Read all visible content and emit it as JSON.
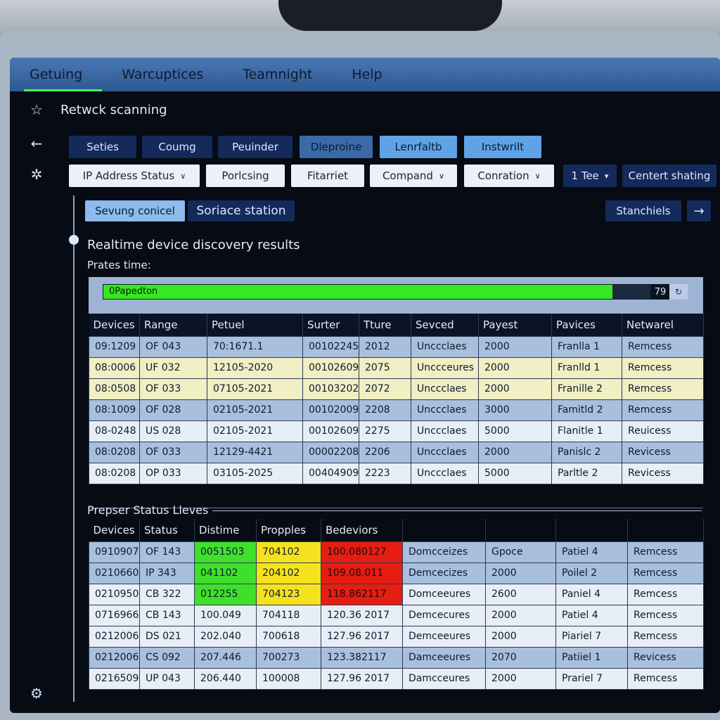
{
  "menu": {
    "items": [
      "Getuing",
      "Warcuptices",
      "Teamnight",
      "Help"
    ]
  },
  "page": {
    "title": "Retwck scanning"
  },
  "rail": {
    "icons": [
      "star-icon",
      "back-arrow-icon",
      "settings-gear-icon",
      "settings-gear-icon"
    ]
  },
  "toolbar1": {
    "buttons": [
      "Seties",
      "Coumg",
      "Peuinder",
      "Dleproine",
      "Lenrfaltb",
      "Instwrilt"
    ]
  },
  "toolbar2": {
    "buttons": [
      "IP Address Status",
      "Porlcsing",
      "Fitarriet",
      "Compand",
      "Conration",
      "1 Tee",
      "Centert shating"
    ]
  },
  "toolbar3": {
    "left": [
      "Sevung conicel",
      "Soriace station"
    ],
    "right": "Stanchiels",
    "arrow": "→"
  },
  "section1": {
    "title": "Realtime device discovery results",
    "subtitle": "Prates time:",
    "progress": {
      "label": "0Papedton",
      "value": "79",
      "percent": 93
    },
    "headers": [
      "Devices",
      "Range",
      "Petuel",
      "Surter",
      "Tture",
      "Sevced",
      "Payest",
      "Pavices",
      "Netwarel"
    ],
    "rows": [
      [
        "09:1209",
        "OF 043",
        "70:1671.1",
        "00102245",
        "2012",
        "Unccclaes",
        "2000",
        "Franlla 1",
        "Remcess"
      ],
      [
        "08:0006",
        "UF 032",
        "12105-2020",
        "00102609",
        "2075",
        "Unccceures",
        "2000",
        "Franlld 1",
        "Remcess"
      ],
      [
        "08:0508",
        "OF 033",
        "07105-2021",
        "00103202",
        "2072",
        "Unccclaes",
        "2000",
        "Franille 2",
        "Remcess"
      ],
      [
        "08:1009",
        "OF 028",
        "02105-2021",
        "00102009",
        "2208",
        "Unccclaes",
        "3000",
        "Famitld 2",
        "Remcess"
      ],
      [
        "08-0248",
        "US 028",
        "02105-2021",
        "00102609",
        "2275",
        "Unccclaes",
        "5000",
        "Flanitle 1",
        "Reuicess"
      ],
      [
        "08:0208",
        "OF 033",
        "12129-4421",
        "00002208",
        "2206",
        "Unccclaes",
        "2000",
        "Panislc 2",
        "Revicess"
      ],
      [
        "08:0208",
        "OP 033",
        "03105-2025",
        "00404909",
        "2223",
        "Unccclaes",
        "5000",
        "Parltle 2",
        "Revicess"
      ]
    ]
  },
  "section2": {
    "title": "Prepser Status Lleves",
    "headers": [
      "Devices",
      "Status",
      "Distime",
      "Propples",
      "Bedeviors"
    ],
    "rows": [
      [
        "0910907",
        "OF 143",
        "0051503",
        "704102",
        "100.080127",
        "Domcceizes",
        "Gpoce",
        "Patiel 4",
        "Remcess"
      ],
      [
        "0210660",
        "IP 343",
        "041102",
        "204102",
        "109.08.011",
        "Demcecizes",
        "2000",
        "Poilel 2",
        "Remcess"
      ],
      [
        "0210950",
        "CB 322",
        "012255",
        "704123",
        "118.862117",
        "Domceeures",
        "2600",
        "Paniel 4",
        "Remcess"
      ],
      [
        "0716966",
        "CB 143",
        "100.049",
        "704118",
        "120.36 2017",
        "Demcecures",
        "2000",
        "Patiel 4",
        "Remcess"
      ],
      [
        "0212006",
        "DS 021",
        "202.040",
        "700618",
        "127.96 2017",
        "Demceeures",
        "2000",
        "Piariel 7",
        "Remcess"
      ],
      [
        "0212006",
        "CS 092",
        "207.446",
        "700273",
        "123.382117",
        "Damceeures",
        "2070",
        "Patiiel 1",
        "Revicess"
      ],
      [
        "0216509",
        "UP 043",
        "206.440",
        "100008",
        "127.96 2017",
        "Damcceures",
        "2000",
        "Prariel 7",
        "Remcess"
      ]
    ]
  },
  "colors": {
    "accent": "#3fff5a",
    "menubar": "#2e5890",
    "progress": "#36e81f",
    "good": "#3fe02a",
    "warn": "#f4e21f",
    "bad": "#e51d12"
  }
}
